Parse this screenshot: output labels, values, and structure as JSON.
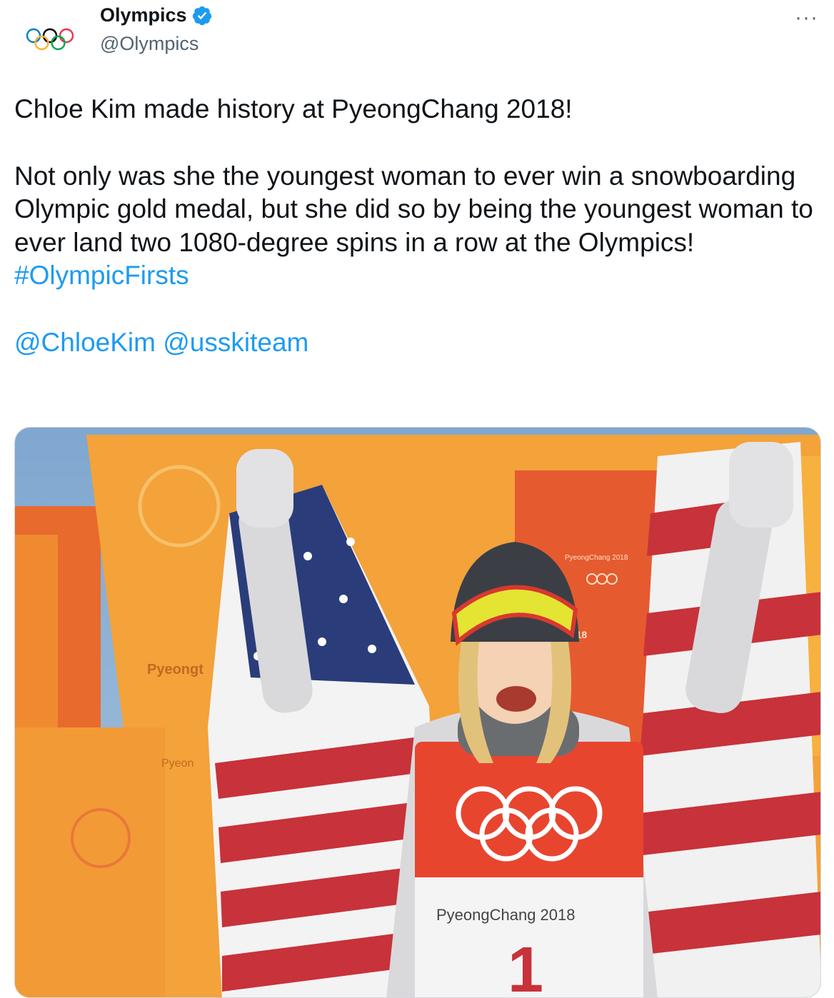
{
  "account": {
    "display_name": "Olympics",
    "handle": "@Olympics",
    "verified": true,
    "avatar_icon": "olympic-rings-icon"
  },
  "more_icon": "more-horizontal-icon",
  "tweet": {
    "line1": "Chloe Kim made history at PyeongChang 2018!",
    "line2": "Not only was she the youngest woman to ever win a snowboarding Olympic gold medal, but she did so by being the youngest woman to ever land two 1080-degree spins in a row at the Olympics! ",
    "hashtag": "#OlympicFirsts",
    "mention1": "@ChloeKim",
    "mention2": "@usskiteam"
  },
  "media": {
    "banner_text_left": "Pyeongt",
    "banner_text_left2": "Pyeon",
    "banner_logo_text": "PyeongChang 2018",
    "banner_year": "2018",
    "bib_text": "PyeongChang 2018",
    "bib_number": "1"
  },
  "colors": {
    "link": "#1d9bf0",
    "verified": "#1d9bf0",
    "banner_orange": "#f39a2e",
    "banner_red": "#e35a2a"
  }
}
